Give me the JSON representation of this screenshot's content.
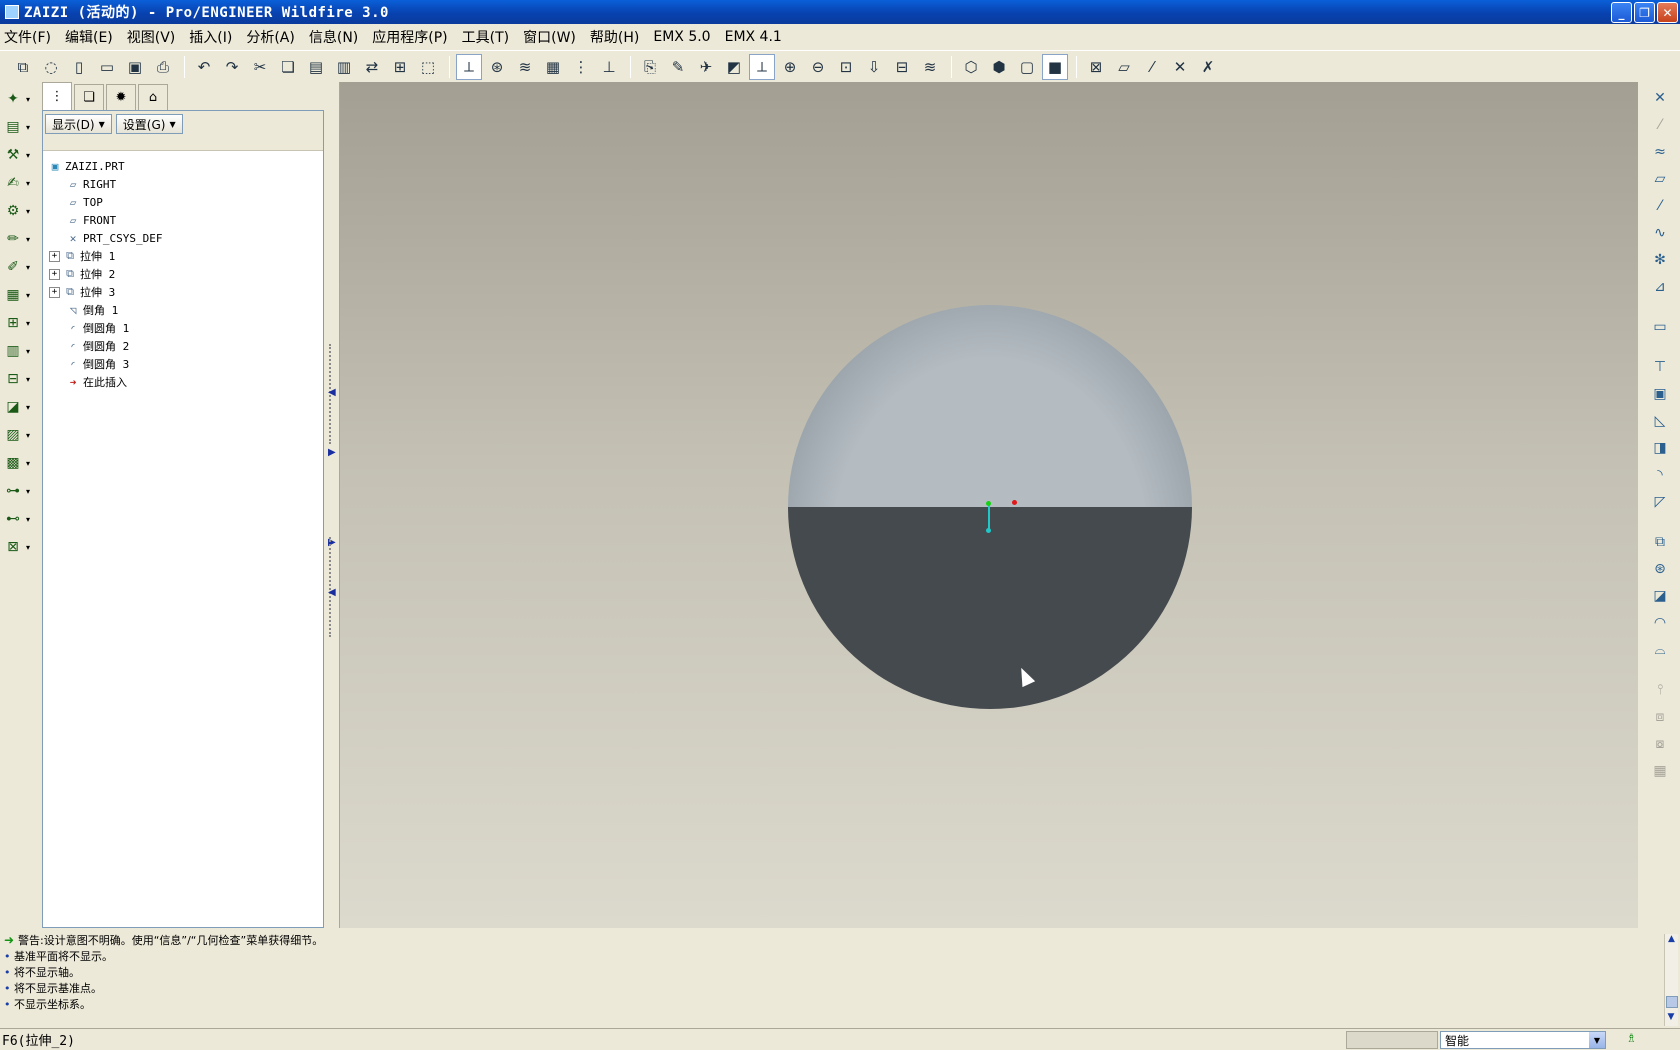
{
  "window": {
    "title": "ZAIZI (活动的) - Pro/ENGINEER Wildfire 3.0",
    "minimize": "_",
    "maximize": "❐",
    "close": "✕"
  },
  "menu": [
    "文件(F)",
    "编辑(E)",
    "视图(V)",
    "插入(I)",
    "分析(A)",
    "信息(N)",
    "应用程序(P)",
    "工具(T)",
    "窗口(W)",
    "帮助(H)",
    "EMX 5.0",
    "EMX 4.1"
  ],
  "toolbar_icons": [
    "new-window-icon",
    "erase-icon",
    "new-file-icon",
    "open-icon",
    "save-icon",
    "print-icon",
    "undo-icon",
    "redo-icon",
    "cut-icon",
    "copy-icon",
    "paste-icon",
    "paste-special-icon",
    "regenerate-icon",
    "find-icon",
    "selection-box-icon",
    "datum-plane-display-icon",
    "axis-display-icon",
    "layers-icon",
    "model-display-icon",
    "tree-icon",
    "filter-icon",
    "orient-icon",
    "spin-center-icon",
    "named-views-icon",
    "refit-icon",
    "zoom-in-icon",
    "zoom-out-icon",
    "zoom-box-icon",
    "reorient-icon",
    "saved-views-icon",
    "layer-tree-icon",
    "wireframe-icon",
    "hidden-line-icon",
    "no-hidden-icon",
    "shading-icon",
    "datum-planes-icon",
    "axes-icon",
    "points-icon",
    "csys-icon",
    "annotations-icon"
  ],
  "left_tools": [
    "new-icon",
    "drawing-icon",
    "pipe-icon",
    "sketch-icon",
    "flexible-icon",
    "edit-icon",
    "rotate-icon",
    "frame-icon",
    "process-icon",
    "database-icon",
    "layout-icon",
    "stock-icon",
    "mold-icon",
    "component-icon",
    "assembly-icon",
    "wire-icon",
    "electrode-icon"
  ],
  "tree": {
    "tabs": [
      "model-tree-tab",
      "layer-tab",
      "favorites-tab",
      "folder-tab"
    ],
    "show_label": "显示(D)",
    "settings_label": "设置(G)",
    "items": [
      {
        "label": "ZAIZI.PRT",
        "icon": "part-icon",
        "expand": ""
      },
      {
        "label": "RIGHT",
        "icon": "datum-plane-icon",
        "expand": ""
      },
      {
        "label": "TOP",
        "icon": "datum-plane-icon",
        "expand": ""
      },
      {
        "label": "FRONT",
        "icon": "datum-plane-icon",
        "expand": ""
      },
      {
        "label": "PRT_CSYS_DEF",
        "icon": "csys-icon",
        "expand": ""
      },
      {
        "label": "拉伸 1",
        "icon": "extrude-icon",
        "expand": "+"
      },
      {
        "label": "拉伸 2",
        "icon": "extrude-icon",
        "expand": "+"
      },
      {
        "label": "拉伸 3",
        "icon": "extrude-icon",
        "expand": "+"
      },
      {
        "label": "倒角 1",
        "icon": "chamfer-icon",
        "expand": ""
      },
      {
        "label": "倒圆角 1",
        "icon": "round-icon",
        "expand": ""
      },
      {
        "label": "倒圆角 2",
        "icon": "round-icon",
        "expand": ""
      },
      {
        "label": "倒圆角 3",
        "icon": "round-icon",
        "expand": ""
      },
      {
        "label": "在此插入",
        "icon": "insert-here-icon",
        "expand": ""
      }
    ]
  },
  "right_tools": [
    "point-icon",
    "sketched-curve-icon",
    "curve-icon",
    "plane-icon",
    "axis-icon",
    "spline-icon",
    "csys-icon",
    "analysis-icon",
    "annotation-icon",
    "hole-icon",
    "shell-icon",
    "rib-icon",
    "draft-icon",
    "round-icon",
    "chamfer-icon",
    "extrude-icon",
    "revolve-icon",
    "sweep-icon",
    "blend-icon",
    "boundary-icon",
    "mirror-icon",
    "merge-icon",
    "intersect-icon",
    "pattern-icon"
  ],
  "messages": [
    {
      "type": "warning",
      "text": "警告:设计意图不明确。使用“信息”/“几何检查”菜单获得细节。"
    },
    {
      "type": "info",
      "text": "基准平面将不显示。"
    },
    {
      "type": "info",
      "text": "将不显示轴。"
    },
    {
      "type": "info",
      "text": "将不显示基准点。"
    },
    {
      "type": "info",
      "text": "不显示坐标系。"
    }
  ],
  "status": {
    "text": "F6(拉伸_2)",
    "filter": "智能"
  },
  "colors": {
    "accent": "#0a5fd8",
    "upper_surface": "#b4bcc2",
    "lower_surface": "#454a4f",
    "background_top": "#a39f93",
    "background_bottom": "#dcdacd"
  }
}
